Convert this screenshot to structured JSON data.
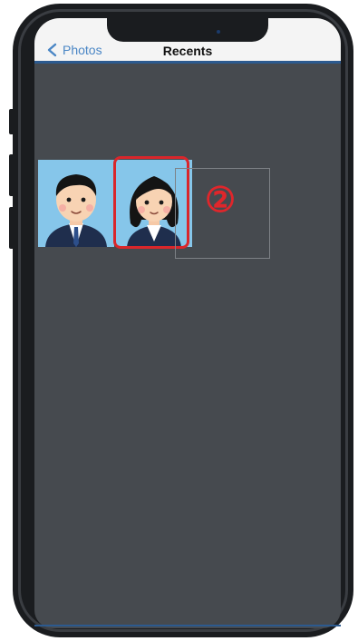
{
  "navbar": {
    "back_label": "Photos",
    "title": "Recents"
  },
  "photos": [
    {
      "subject": "man-in-suit"
    },
    {
      "subject": "woman-in-suit",
      "selected": true
    }
  ],
  "annotation": {
    "step_marker": "②"
  },
  "colors": {
    "accent": "#4a86c5",
    "selection": "#d9262b",
    "screen_bg": "#464a4f"
  }
}
